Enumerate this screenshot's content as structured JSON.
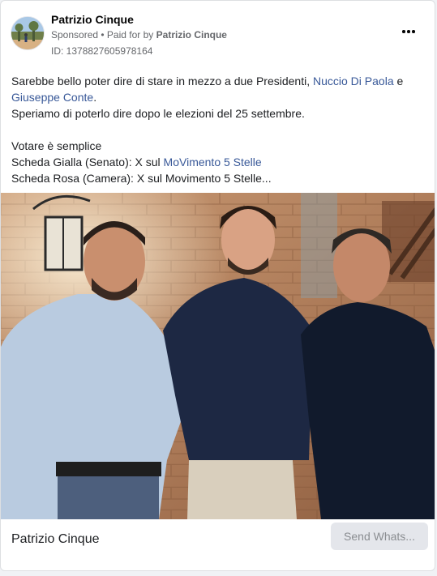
{
  "ad": {
    "page_name": "Patrizio Cinque",
    "sponsored_label": "Sponsored",
    "separator": " • ",
    "paid_for_label": "Paid for by",
    "paid_for_name": "Patrizio Cinque",
    "id_label": "ID: 1378827605978164"
  },
  "body": {
    "line1_prefix": "Sarebbe bello poter dire di stare in mezzo a due Presidenti, ",
    "mention1": "Nuccio Di Paola",
    "line1_mid": " e",
    "mention2": "Giuseppe Conte",
    "line2_suffix": ".",
    "line3": "Speriamo di poterlo dire dopo le elezioni del 25 settembre.",
    "line4": "Votare è semplice",
    "line5_prefix": "Scheda Gialla (Senato): X sul ",
    "mention3": "MoVimento 5 Stelle",
    "line6": "Scheda Rosa (Camera): X sul Movimento 5 Stelle..."
  },
  "footer": {
    "page_name": "Patrizio Cinque",
    "cta_label": "Send Whats..."
  },
  "colors": {
    "link": "#385898",
    "text": "#1c1e21",
    "muted": "#65676b",
    "button_bg": "#e4e6eb"
  },
  "icons": {
    "more": "more-horizontal-icon"
  }
}
